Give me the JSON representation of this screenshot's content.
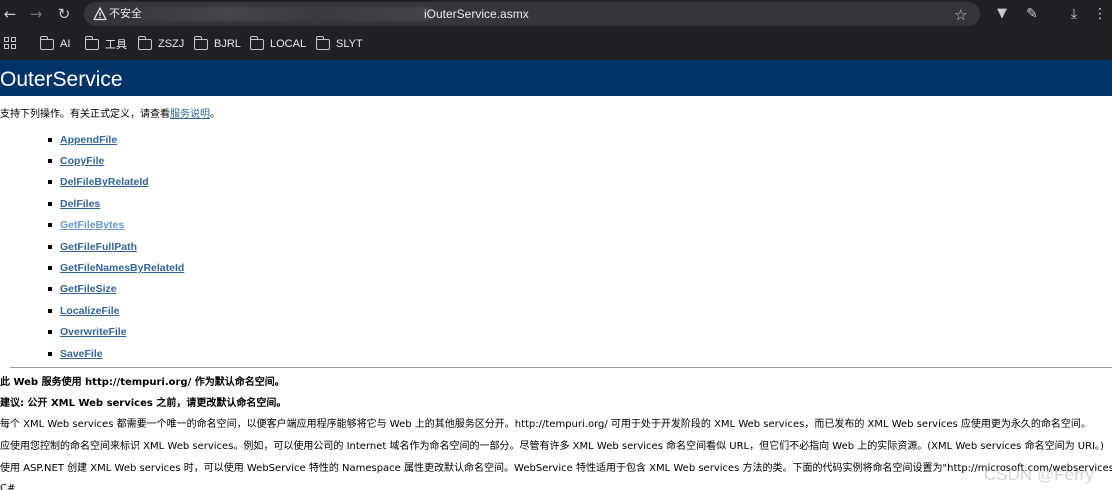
{
  "browser": {
    "security_label": "不安全",
    "url_suffix": "iOuterService.asmx",
    "bookmarks": [
      "AI",
      "工具",
      "ZSZJ",
      "BJRL",
      "LOCAL",
      "SLYT"
    ]
  },
  "page": {
    "title": "OuterService",
    "intro_text": "支持下列操作。有关正式定义，请查看",
    "intro_link": "服务说明",
    "intro_end": "。",
    "operations": [
      "AppendFile",
      "CopyFile",
      "DelFileByRelateId",
      "DelFiles",
      "GetFileBytes",
      "GetFileFullPath",
      "GetFileNamesByRelateId",
      "GetFileSize",
      "LocalizeFile",
      "OverwriteFile",
      "SaveFile"
    ],
    "namespace_notice": "此 Web 服务使用 http://tempuri.org/ 作为默认命名空间。",
    "recommendation": "建议: 公开 XML Web services 之前，请更改默认命名空间。",
    "para1": "每个 XML Web services 都需要一个唯一的命名空间，以便客户端应用程序能够将它与 Web 上的其他服务区分开。http://tempuri.org/ 可用于处于开发阶段的 XML Web services，而已发布的 XML Web services 应使用更为永久的命名空间。",
    "para2": "应使用您控制的命名空间来标识 XML Web services。例如，可以使用公司的 Internet 域名作为命名空间的一部分。尽管有许多 XML Web services 命名空间看似 URL，但它们不必指向 Web 上的实际资源。(XML Web services 命名空间为 URI。)",
    "para3": "使用 ASP.NET 创建 XML Web services 时，可以使用 WebService 特性的 Namespace 属性更改默认命名空间。WebService 特性适用于包含 XML Web services 方法的类。下面的代码实例将命名空间设置为\"http://microsoft.com/webservices/\":",
    "para4": "C#"
  },
  "watermark": "CSDN @Ferry"
}
